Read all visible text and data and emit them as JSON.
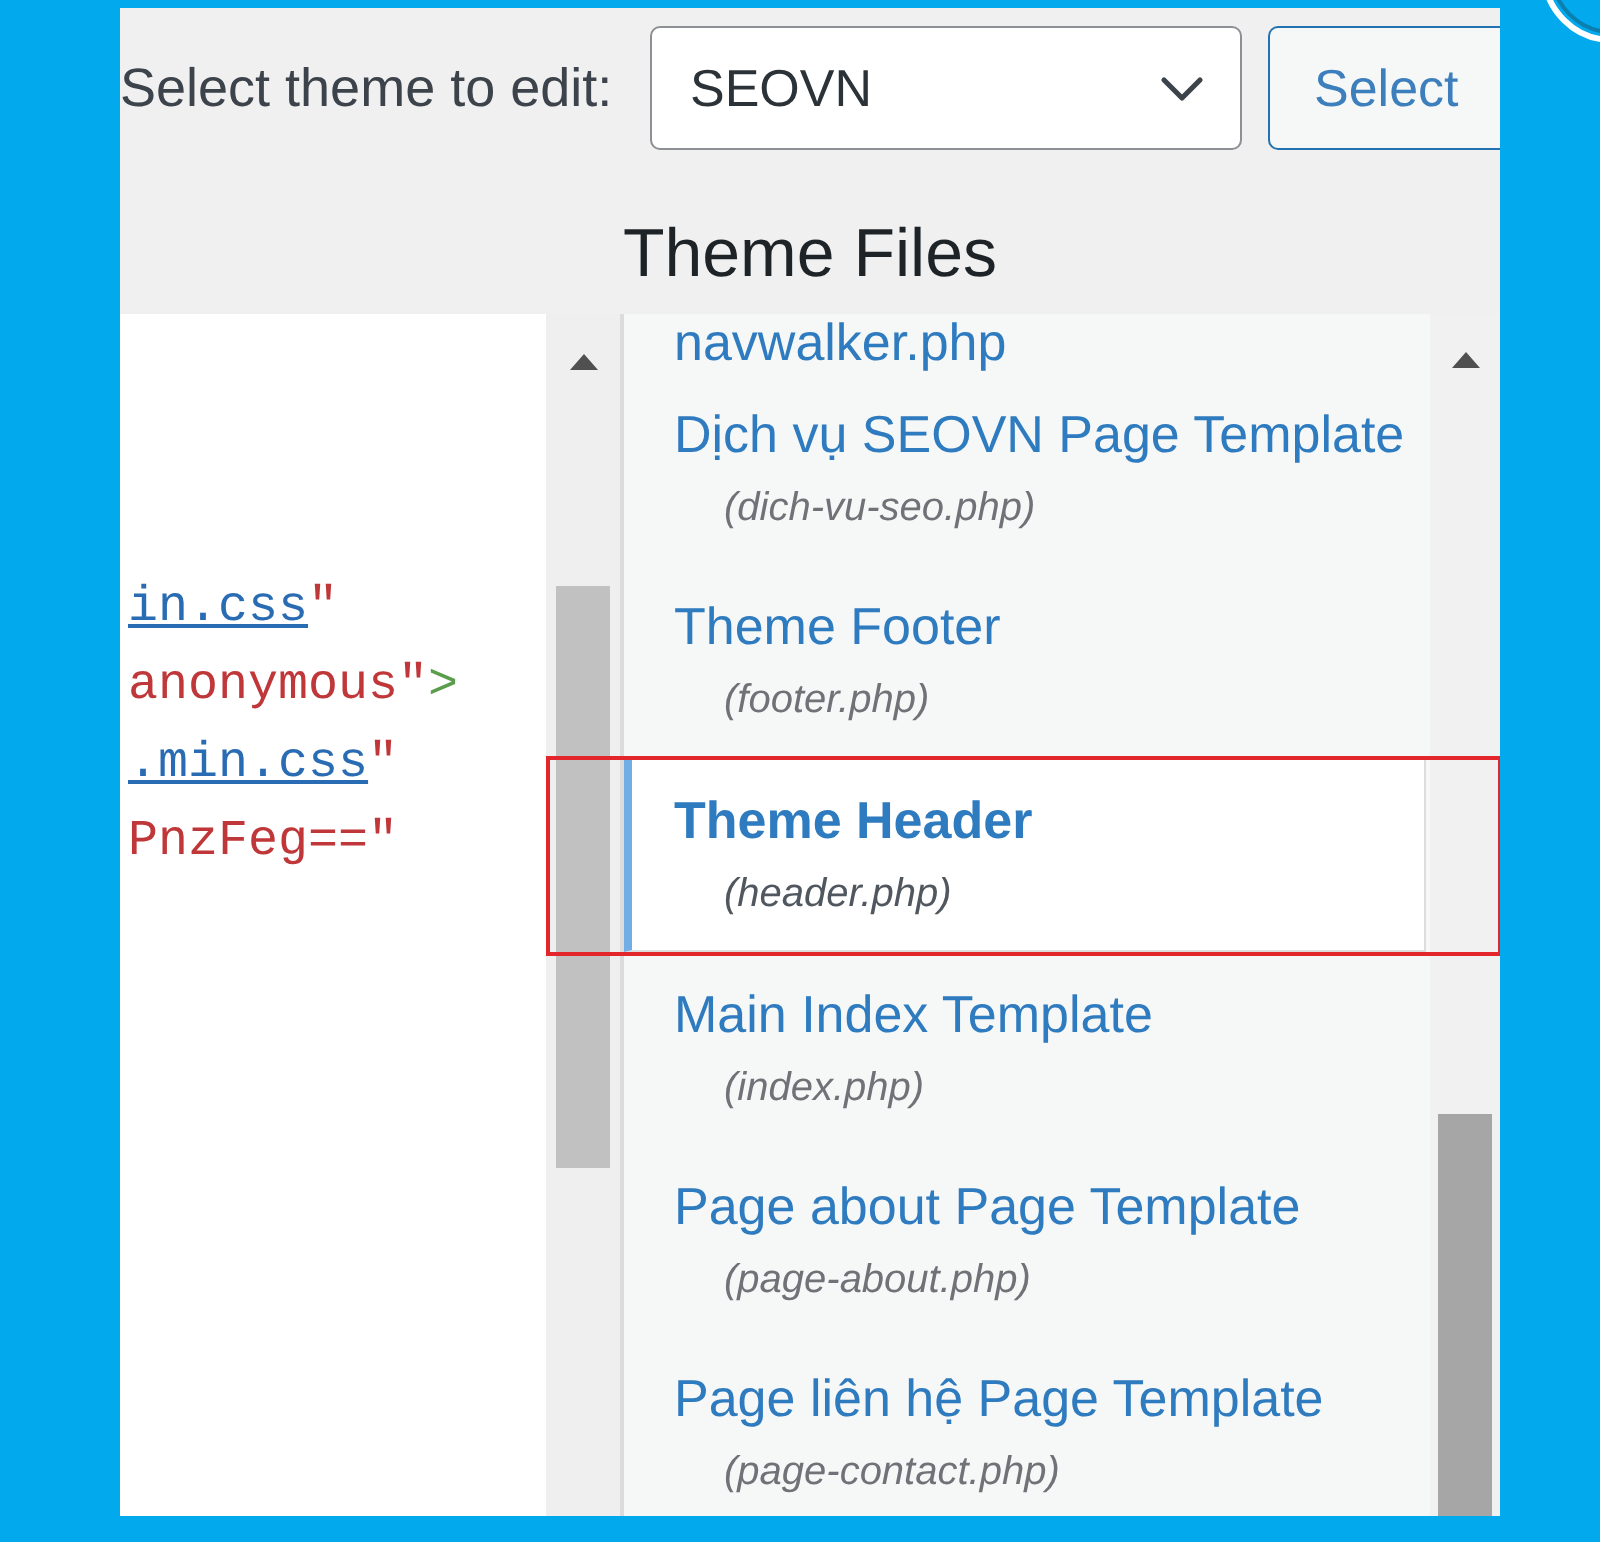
{
  "theme_picker": {
    "label": "Select theme to edit:",
    "value": "SEOVN",
    "button": "Select"
  },
  "heading": "Theme Files",
  "code_lines": [
    [
      {
        "kind": "link",
        "text": "in.css"
      },
      {
        "kind": "string",
        "text": "\""
      }
    ],
    [
      {
        "kind": "string",
        "text": "anonymous\""
      },
      {
        "kind": "tag",
        "text": ">"
      }
    ],
    [
      {
        "kind": "link",
        "text": ".min.css"
      },
      {
        "kind": "string",
        "text": "\""
      }
    ],
    [
      {
        "kind": "string",
        "text": "PnzFeg==\""
      }
    ]
  ],
  "files": [
    {
      "title": "navwalker.php",
      "selected": false,
      "highlighted": false
    },
    {
      "title": "Dịch vụ SEOVN Page Template",
      "file": "(dich-vu-seo.php)",
      "selected": false,
      "highlighted": false
    },
    {
      "title": "Theme Footer",
      "file": "(footer.php)",
      "selected": false,
      "highlighted": false
    },
    {
      "title": "Theme Header",
      "file": "(header.php)",
      "selected": true,
      "highlighted": true
    },
    {
      "title": "Main Index Template",
      "file": "(index.php)",
      "selected": false,
      "highlighted": false
    },
    {
      "title": "Page about Page Template",
      "file": "(page-about.php)",
      "selected": false,
      "highlighted": false
    },
    {
      "title": "Page liên hệ Page Template",
      "file": "(page-contact.php)",
      "selected": false,
      "highlighted": false
    }
  ]
}
